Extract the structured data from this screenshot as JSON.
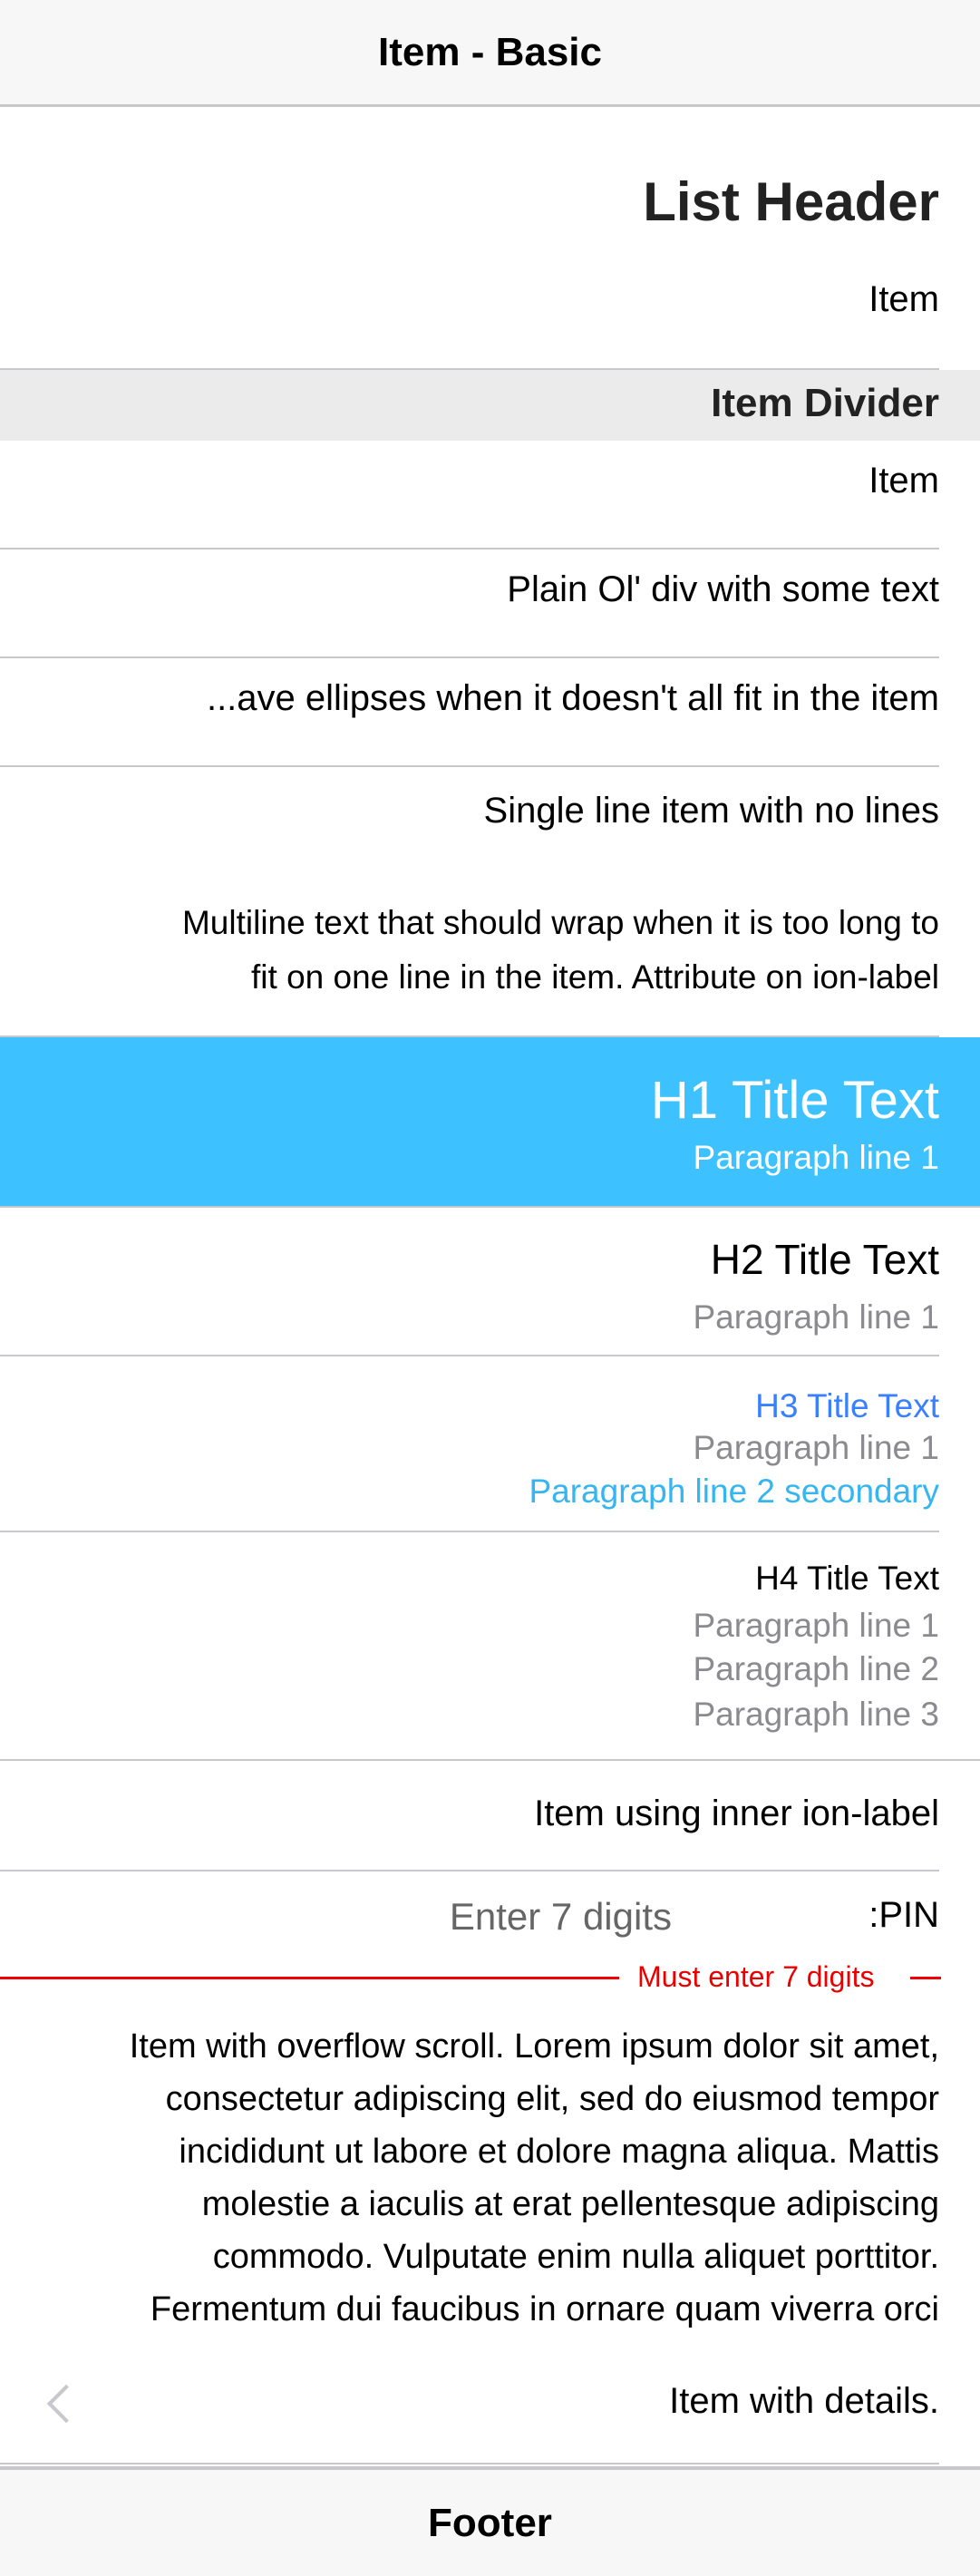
{
  "toolbar": {
    "title": "Item - Basic"
  },
  "list": {
    "header": "List Header",
    "item1": "Item",
    "divider": "Item Divider",
    "item2": "Item",
    "plain_div": "Plain Ol' div with some text",
    "ellipsis": "...ave ellipses when it doesn't all fit in the item",
    "single_line": "Single line item with no lines",
    "multiline_1": "Multiline text that should wrap when it is too long to",
    "multiline_2": "fit on one line in the item. Attribute on ion-label",
    "h1": {
      "title": "H1 Title Text",
      "p1": "Paragraph line 1"
    },
    "h2": {
      "title": "H2 Title Text",
      "p1": "Paragraph line 1"
    },
    "h3": {
      "title": "H3 Title Text",
      "p1": "Paragraph line 1",
      "p2": "Paragraph line 2 secondary"
    },
    "h4": {
      "title": "H4 Title Text",
      "p1": "Paragraph line 1",
      "p2": "Paragraph line 2",
      "p3": "Paragraph line 3"
    },
    "inner_label": "Item using inner ion-label",
    "pin": {
      "label": ":PIN",
      "placeholder": "Enter 7 digits",
      "value": "",
      "error": "Must enter 7 digits"
    },
    "overflow_lines": [
      "Item with overflow scroll. Lorem ipsum dolor sit amet,",
      "consectetur adipiscing elit, sed do eiusmod tempor",
      "incididunt ut labore et dolore magna aliqua. Mattis",
      "molestie a iaculis at erat pellentesque adipiscing",
      "commodo. Vulputate enim nulla aliquet porttitor.",
      "Fermentum dui faucibus in ornare quam viverra orci"
    ],
    "details": "Item with details."
  },
  "footer": {
    "title": "Footer"
  },
  "colors": {
    "primary": "#3dc2ff",
    "secondary_text": "#35b6f1",
    "h3_blue": "#3880ff",
    "danger": "#eb0000",
    "divider_bg": "#ebebeb",
    "toolbar_bg": "#f7f7f7"
  },
  "icons": {
    "detail": "chevron-left-icon"
  }
}
